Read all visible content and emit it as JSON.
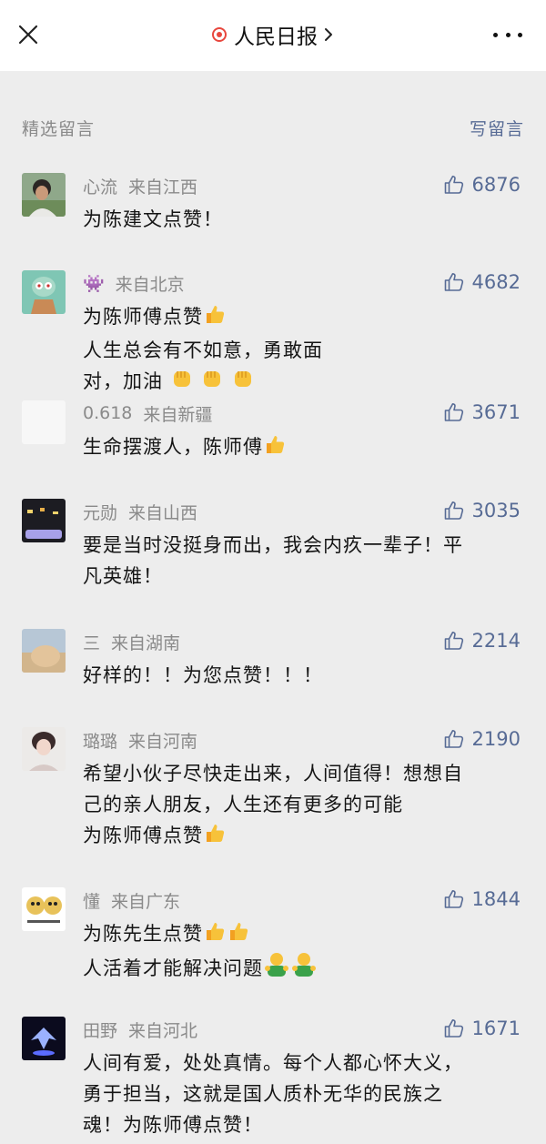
{
  "header": {
    "title": "人民日报",
    "close_icon": "close-icon",
    "more_icon": "more-icon",
    "accent": "#e8473e"
  },
  "section": {
    "title": "精选留言",
    "write_label": "写留言",
    "link_color": "#576b95"
  },
  "comments": [
    {
      "nickname": "心流",
      "location": "来自江西",
      "likes": "6876",
      "lines": [
        "为陈建文点赞！"
      ]
    },
    {
      "nickname": "👾",
      "location": "来自北京",
      "likes": "4682",
      "lines": [
        "为陈师傅点赞",
        "人生总会有不如意，勇敢面",
        "对，加油"
      ]
    },
    {
      "nickname": "0.618",
      "location": "来自新疆",
      "likes": "3671",
      "lines": [
        "生命摆渡人，陈师傅"
      ]
    },
    {
      "nickname": "元勋",
      "location": "来自山西",
      "likes": "3035",
      "lines": [
        "要是当时没挺身而出，我会内疚一辈子！平",
        "凡英雄！"
      ]
    },
    {
      "nickname": "三",
      "location": "来自湖南",
      "likes": "2214",
      "lines": [
        "好样的！！为您点赞！！！"
      ]
    },
    {
      "nickname": "璐璐",
      "location": "来自河南",
      "likes": "2190",
      "lines": [
        "希望小伙子尽快走出来，人间值得！想想自",
        "己的亲人朋友，人生还有更多的可能",
        "为陈师傅点赞"
      ]
    },
    {
      "nickname": "懂",
      "location": "来自广东",
      "likes": "1844",
      "lines": [
        "为陈先生点赞",
        "人活着才能解决问题"
      ]
    },
    {
      "nickname": "田野",
      "location": "来自河北",
      "likes": "1671",
      "lines": [
        "人间有爱，处处真情。每个人都心怀大义，",
        "勇于担当，这就是国人质朴无华的民族之",
        "魂！为陈师傅点赞！"
      ]
    }
  ]
}
